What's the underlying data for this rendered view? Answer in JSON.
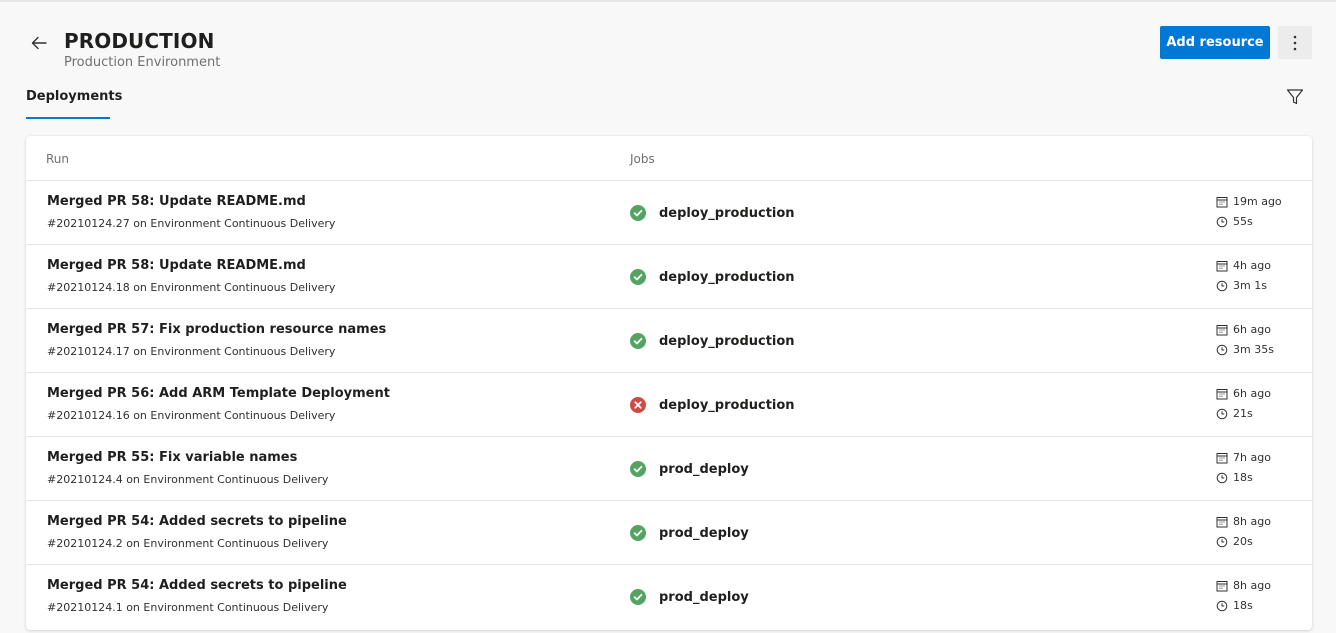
{
  "header": {
    "title": "PRODUCTION",
    "subtitle": "Production Environment",
    "add_resource_label": "Add resource"
  },
  "tabs": [
    {
      "label": "Deployments",
      "selected": true
    }
  ],
  "table": {
    "columns": [
      "Run",
      "Jobs"
    ],
    "rows": [
      {
        "title": "Merged PR 58: Update README.md",
        "run_id": "#20210124.27",
        "on_text": "on",
        "pipeline": "Environment Continuous Delivery",
        "job": "deploy_production",
        "status": "success",
        "when": "19m ago",
        "duration": "55s"
      },
      {
        "title": "Merged PR 58: Update README.md",
        "run_id": "#20210124.18",
        "on_text": "on",
        "pipeline": "Environment Continuous Delivery",
        "job": "deploy_production",
        "status": "success",
        "when": "4h ago",
        "duration": "3m 1s"
      },
      {
        "title": "Merged PR 57: Fix production resource names",
        "run_id": "#20210124.17",
        "on_text": "on",
        "pipeline": "Environment Continuous Delivery",
        "job": "deploy_production",
        "status": "success",
        "when": "6h ago",
        "duration": "3m 35s"
      },
      {
        "title": "Merged PR 56: Add ARM Template Deployment",
        "run_id": "#20210124.16",
        "on_text": "on",
        "pipeline": "Environment Continuous Delivery",
        "job": "deploy_production",
        "status": "failed",
        "when": "6h ago",
        "duration": "21s"
      },
      {
        "title": "Merged PR 55: Fix variable names",
        "run_id": "#20210124.4",
        "on_text": "on",
        "pipeline": "Environment Continuous Delivery",
        "job": "prod_deploy",
        "status": "success",
        "when": "7h ago",
        "duration": "18s"
      },
      {
        "title": "Merged PR 54: Added secrets to pipeline",
        "run_id": "#20210124.2",
        "on_text": "on",
        "pipeline": "Environment Continuous Delivery",
        "job": "prod_deploy",
        "status": "success",
        "when": "8h ago",
        "duration": "20s"
      },
      {
        "title": "Merged PR 54: Added secrets to pipeline",
        "run_id": "#20210124.1",
        "on_text": "on",
        "pipeline": "Environment Continuous Delivery",
        "job": "prod_deploy",
        "status": "success",
        "when": "8h ago",
        "duration": "18s"
      }
    ]
  },
  "colors": {
    "accent": "#0078d4",
    "success": "#55a362",
    "failed": "#cd4a45"
  },
  "icons": {
    "back": "arrow-left-icon",
    "more": "more-vertical-icon",
    "filter": "filter-icon",
    "success": "check-circle-icon",
    "failed": "error-circle-icon",
    "calendar": "calendar-icon",
    "clock": "clock-icon"
  }
}
